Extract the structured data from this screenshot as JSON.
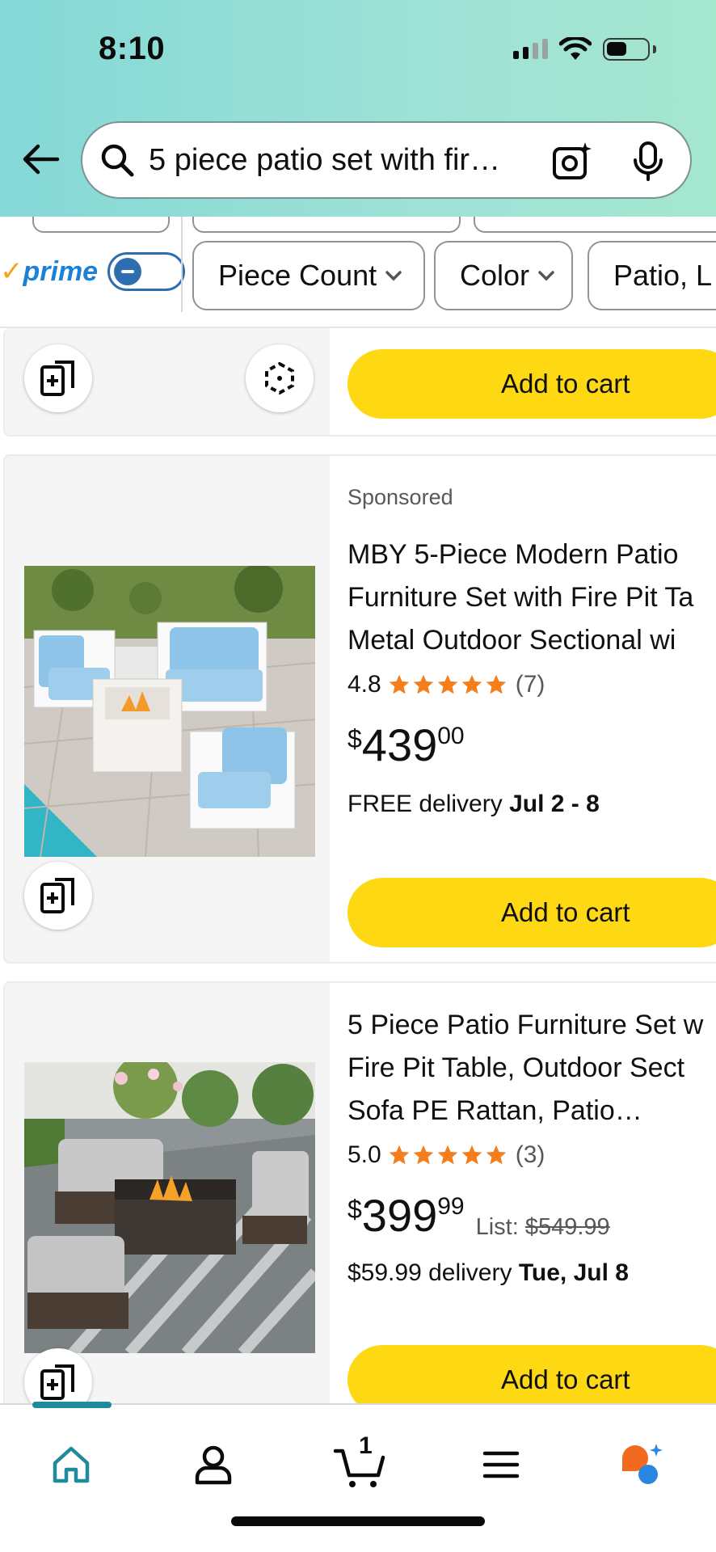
{
  "status_bar": {
    "time": "8:10"
  },
  "search": {
    "query": "5 piece patio set with fir…"
  },
  "filters": {
    "prime_label": "prime",
    "chips": [
      {
        "label": "Piece Count"
      },
      {
        "label": "Color"
      },
      {
        "label": "Patio, L"
      }
    ]
  },
  "results": [
    {
      "add_to_cart": "Add to cart"
    },
    {
      "sponsored": "Sponsored",
      "title_lines": [
        "MBY 5-Piece Modern Patio",
        "Furniture Set with Fire Pit Ta",
        "Metal Outdoor Sectional wi"
      ],
      "rating": "4.8",
      "review_count": "(7)",
      "price": {
        "symbol": "$",
        "whole": "439",
        "fraction": "00"
      },
      "delivery_prefix": "FREE delivery ",
      "delivery_date": "Jul 2 - 8",
      "add_to_cart": "Add to cart"
    },
    {
      "title_lines": [
        "5 Piece Patio Furniture Set w",
        "Fire Pit Table, Outdoor Sect",
        "Sofa PE Rattan, Patio…"
      ],
      "rating": "5.0",
      "review_count": "(3)",
      "price": {
        "symbol": "$",
        "whole": "399",
        "fraction": "99"
      },
      "list_label": "List: ",
      "list_price": "$549.99",
      "delivery_prefix": "$59.99 delivery ",
      "delivery_date": "Tue, Jul 8",
      "add_to_cart": "Add to cart"
    }
  ],
  "bottom_nav": {
    "items": [
      "home-icon",
      "account-icon",
      "cart-icon",
      "menu-icon",
      "rufus-ai-icon"
    ],
    "cart_count": "1"
  },
  "colors": {
    "header_gradient": [
      "#84d8d6",
      "#a5e6cf"
    ],
    "add_to_cart": "#ffd814",
    "star": "#f47e1c",
    "prime_blue": "#1a82d6",
    "accent_teal": "#1f8a99"
  }
}
